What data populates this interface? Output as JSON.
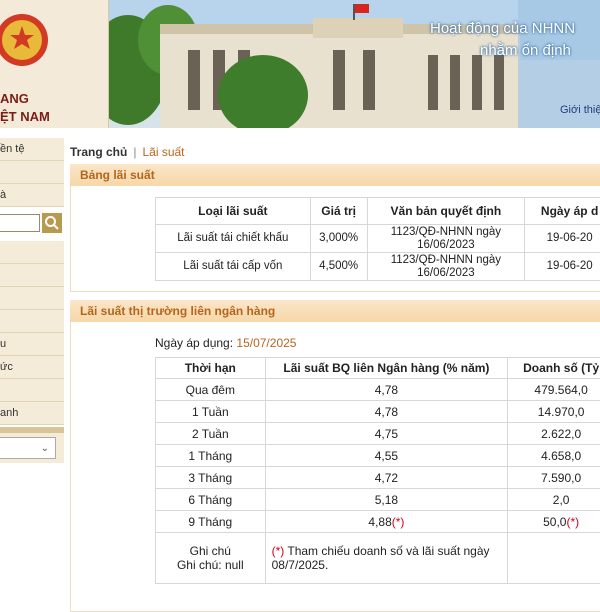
{
  "header": {
    "bank_name_line1": "ANG",
    "bank_name_line2": "ỆT NAM",
    "slogan_line1": "Hoạt động của NHNN",
    "slogan_line2": "nhằm ổn định",
    "intro_link": "Giới thiệ"
  },
  "sidebar": {
    "items_top": [
      "ền tệ",
      "",
      "à"
    ],
    "items_mid": [
      "",
      "",
      "",
      "",
      "u",
      "ức",
      "",
      "anh"
    ]
  },
  "breadcrumb": {
    "home": "Trang chủ",
    "current": "Lãi suất"
  },
  "rates_section": {
    "title": "Bảng lãi suất",
    "columns": [
      "Loại lãi suất",
      "Giá trị",
      "Văn bản quyết định",
      "Ngày áp d"
    ],
    "rows": [
      {
        "type": "Lãi suất tái chiết khấu",
        "value": "3,000%",
        "decision_l1": "1123/QĐ-NHNN ngày",
        "decision_l2": "16/06/2023",
        "date": "19-06-20"
      },
      {
        "type": "Lãi suất tái cấp vốn",
        "value": "4,500%",
        "decision_l1": "1123/QĐ-NHNN ngày",
        "decision_l2": "16/06/2023",
        "date": "19-06-20"
      }
    ]
  },
  "interbank_section": {
    "title": "Lãi suất thị trường liên ngân hàng",
    "apply_label": "Ngày áp dụng:",
    "apply_date": "15/07/2025",
    "columns": [
      "Thời hạn",
      "Lãi suất BQ liên Ngân hàng (% năm)",
      "Doanh số (Tỷ"
    ],
    "rows": [
      {
        "term": "Qua đêm",
        "rate": "4,78",
        "volume": "479.564,0",
        "mark": ""
      },
      {
        "term": "1 Tuần",
        "rate": "4,78",
        "volume": "14.970,0",
        "mark": ""
      },
      {
        "term": "2 Tuần",
        "rate": "4,75",
        "volume": "2.622,0",
        "mark": ""
      },
      {
        "term": "1 Tháng",
        "rate": "4,55",
        "volume": "4.658,0",
        "mark": ""
      },
      {
        "term": "3 Tháng",
        "rate": "4,72",
        "volume": "7.590,0",
        "mark": ""
      },
      {
        "term": "6 Tháng",
        "rate": "5,18",
        "volume": "2,0",
        "mark": ""
      },
      {
        "term": "9 Tháng",
        "rate": "4,88",
        "volume": "50,0",
        "mark": "(*)"
      }
    ],
    "note_label_1": "Ghi chú",
    "note_label_2": "Ghi chú: null",
    "note_mark": "(*)",
    "note_text": " Tham chiếu doanh số và lãi suất ngày 08/7/2025."
  }
}
